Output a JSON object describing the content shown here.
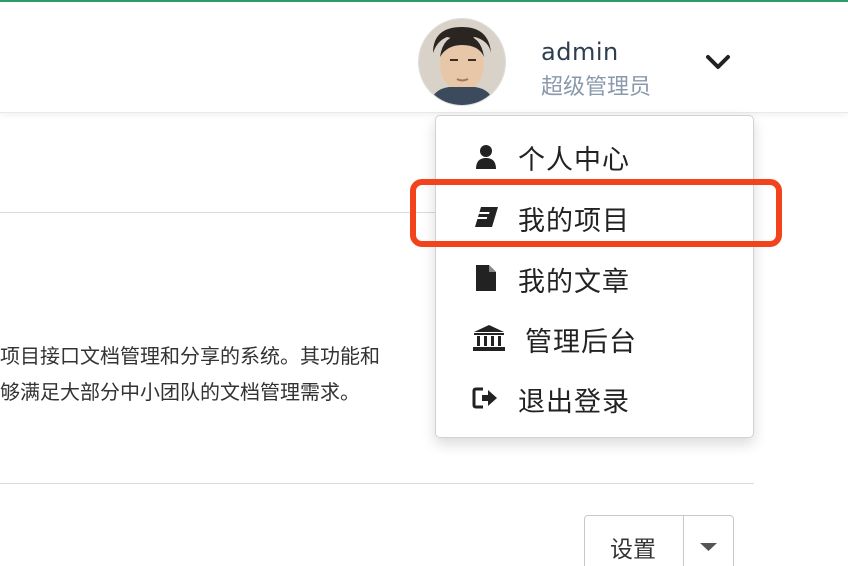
{
  "header": {
    "user_name": "admin",
    "user_role": "超级管理员"
  },
  "menu": {
    "items": [
      {
        "label": "个人中心",
        "icon": "user-icon"
      },
      {
        "label": "我的项目",
        "icon": "book-icon"
      },
      {
        "label": "我的文章",
        "icon": "file-icon"
      },
      {
        "label": "管理后台",
        "icon": "bank-icon"
      },
      {
        "label": "退出登录",
        "icon": "sign-out-icon"
      }
    ]
  },
  "description": {
    "line1": "项目接口文档管理和分享的系统。其功能和",
    "line2": "够满足大部分中小团队的文档管理需求。"
  },
  "settings_button": {
    "label": "设置"
  },
  "colors": {
    "accent_green": "#2e9e6c",
    "highlight": "#f2431b",
    "role_text": "#8a99ab"
  }
}
